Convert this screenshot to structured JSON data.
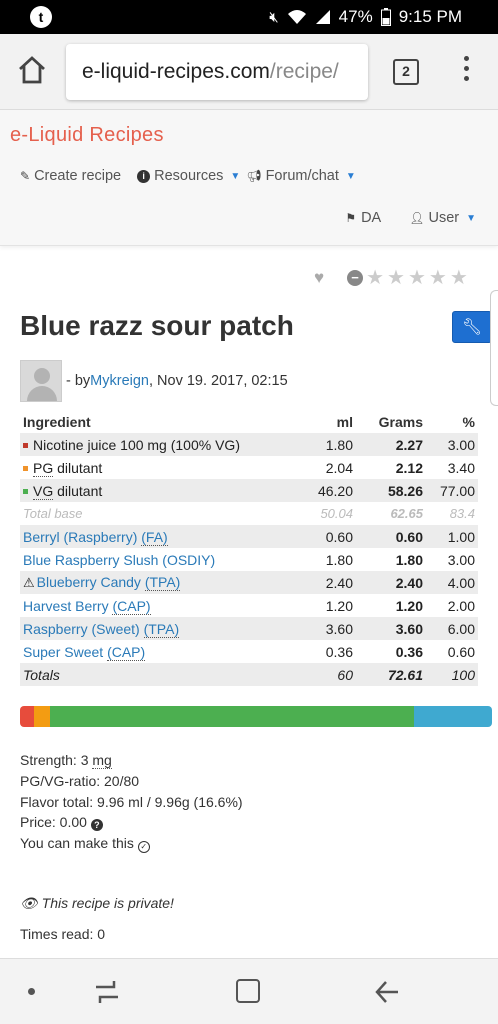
{
  "status_bar": {
    "battery": "47%",
    "time": "9:15 PM"
  },
  "browser": {
    "url_host": "e-liquid-recipes.com",
    "url_path": "/recipe/",
    "tab_count": "2"
  },
  "site": {
    "brand": "e-Liquid Recipes",
    "nav": {
      "create_recipe": "Create recipe",
      "resources": "Resources",
      "forum": "Forum/chat",
      "language": "DA",
      "user": "User"
    }
  },
  "recipe": {
    "title": "Blue razz sour patch",
    "by_prefix": "- by ",
    "author": "Mykreign",
    "date": ", Nov 19. 2017, 02:15"
  },
  "table": {
    "headers": {
      "ingredient": "Ingredient",
      "ml": "ml",
      "grams": "Grams",
      "pct": "%"
    },
    "base_rows": [
      {
        "name": "Nicotine juice 100 mg (100% VG)",
        "ml": "1.80",
        "grams": "2.27",
        "pct": "3.00",
        "color": "#c0392b"
      },
      {
        "name_abbr": "PG",
        "name_rest": " dilutant",
        "ml": "2.04",
        "grams": "2.12",
        "pct": "3.40",
        "color": "#f0932b"
      },
      {
        "name_abbr": "VG",
        "name_rest": " dilutant",
        "ml": "46.20",
        "grams": "58.26",
        "pct": "77.00",
        "color": "#4caf50"
      }
    ],
    "total_base": {
      "label": "Total base",
      "ml": "50.04",
      "grams": "62.65",
      "pct": "83.4"
    },
    "flavors": [
      {
        "name": "Berryl (Raspberry) ",
        "brand": "(FA)",
        "ml": "0.60",
        "grams": "0.60",
        "pct": "1.00",
        "warning": false
      },
      {
        "name": "Blue Raspberry Slush (OSDIY)",
        "brand": "",
        "ml": "1.80",
        "grams": "1.80",
        "pct": "3.00",
        "warning": false
      },
      {
        "name": "Blueberry Candy ",
        "brand": "(TPA)",
        "ml": "2.40",
        "grams": "2.40",
        "pct": "4.00",
        "warning": true
      },
      {
        "name": "Harvest Berry ",
        "brand": "(CAP)",
        "ml": "1.20",
        "grams": "1.20",
        "pct": "2.00",
        "warning": false
      },
      {
        "name": "Raspberry (Sweet) ",
        "brand": "(TPA)",
        "ml": "3.60",
        "grams": "3.60",
        "pct": "6.00",
        "warning": false
      },
      {
        "name": "Super Sweet ",
        "brand": "(CAP)",
        "ml": "0.36",
        "grams": "0.36",
        "pct": "0.60",
        "warning": false
      }
    ],
    "totals": {
      "label": "Totals",
      "ml": "60",
      "grams": "72.61",
      "pct": "100"
    }
  },
  "composition_bar": [
    {
      "name": "nicotine",
      "pct": 3.0,
      "color": "#e74c3c"
    },
    {
      "name": "pg",
      "pct": 3.4,
      "color": "#f39c12"
    },
    {
      "name": "vg",
      "pct": 77.0,
      "color": "#4caf50"
    },
    {
      "name": "flavor",
      "pct": 16.6,
      "color": "#3fa9d0"
    }
  ],
  "info": {
    "strength_label": "Strength: 3 ",
    "strength_unit": "mg",
    "pgvg": "PG/VG-ratio: 20/80",
    "flavor_total": "Flavor total: 9.96 ml / 9.96g (16.6%)",
    "price": "Price: 0.00 ",
    "can_make": "You can make this "
  },
  "private_note": "This recipe is private!",
  "times_read": "Times read: 0"
}
